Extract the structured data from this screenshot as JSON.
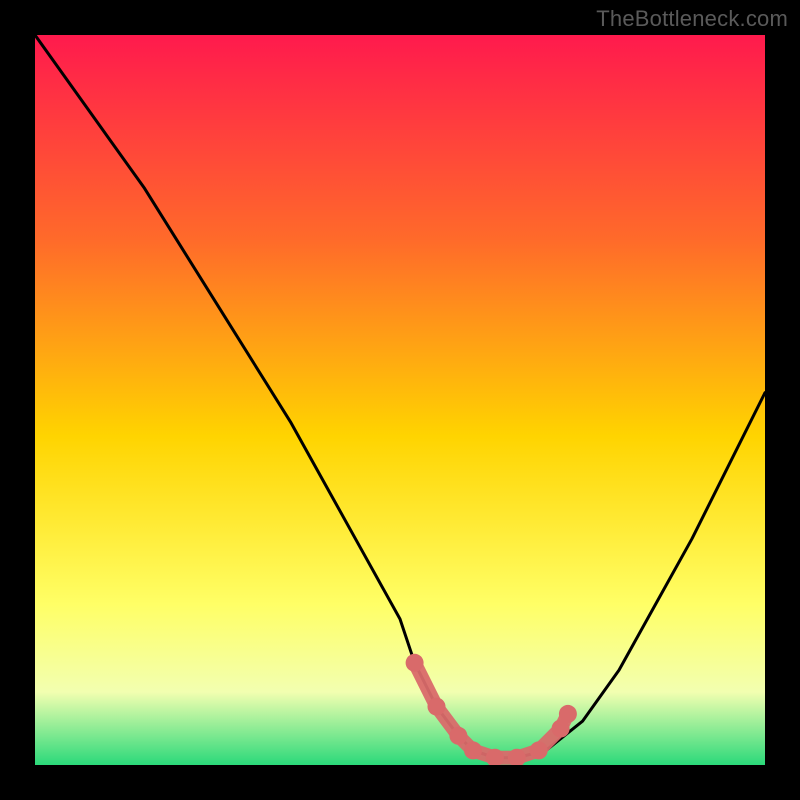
{
  "watermark": "TheBottleneck.com",
  "colors": {
    "bg": "#000000",
    "grad_top": "#ff1a4d",
    "grad_mid1": "#ff6a2a",
    "grad_mid2": "#ffd400",
    "grad_mid3": "#ffff66",
    "grad_mid4": "#f2ffb0",
    "grad_bottom": "#2bd97a",
    "curve": "#000000",
    "marker": "#d96a6a"
  },
  "chart_data": {
    "type": "line",
    "title": "",
    "xlabel": "",
    "ylabel": "",
    "xlim": [
      0,
      100
    ],
    "ylim": [
      0,
      100
    ],
    "series": [
      {
        "name": "bottleneck-curve",
        "x": [
          0,
          5,
          10,
          15,
          20,
          25,
          30,
          35,
          40,
          45,
          50,
          52,
          55,
          58,
          60,
          63,
          66,
          70,
          75,
          80,
          85,
          90,
          95,
          100
        ],
        "y": [
          100,
          93,
          86,
          79,
          71,
          63,
          55,
          47,
          38,
          29,
          20,
          14,
          8,
          4,
          2,
          1,
          1,
          2,
          6,
          13,
          22,
          31,
          41,
          51
        ]
      }
    ],
    "markers": {
      "name": "highlight-range",
      "x": [
        52,
        55,
        58,
        60,
        63,
        66,
        69,
        72,
        73
      ],
      "y": [
        14,
        8,
        4,
        2,
        1,
        1,
        2,
        5,
        7
      ]
    }
  }
}
